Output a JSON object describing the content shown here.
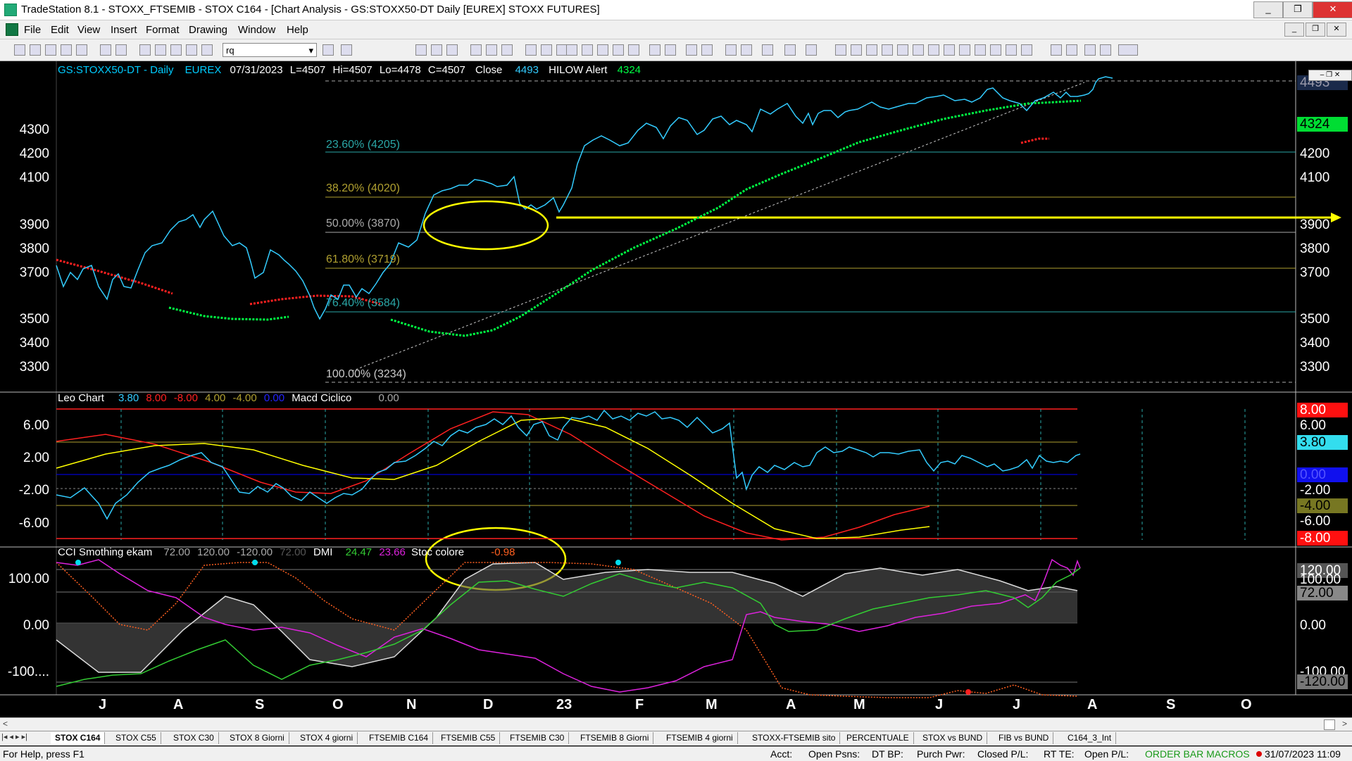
{
  "window": {
    "title": "TradeStation 8.1 - STOXX_FTSEMIB - STOX C164 - [Chart Analysis - GS:STOXX50-DT  Daily  [EUREX] STOXX FUTURES]",
    "controls": [
      "_",
      "❐",
      "✕"
    ]
  },
  "menu": {
    "items": [
      "File",
      "Edit",
      "View",
      "Insert",
      "Format",
      "Drawing",
      "Window",
      "Help"
    ]
  },
  "toolbar": {
    "symbol_value": "rq"
  },
  "price_panel": {
    "header": {
      "symbol": "GS:STOXX50-DT - Daily",
      "exchange": "EUREX",
      "date": "07/31/2023",
      "last": "L=4507",
      "high": "Hi=4507",
      "low": "Lo=4478",
      "close_val": "C=4507",
      "close_label": "Close",
      "close_num": "4493",
      "hilow": "HILOW Alert",
      "hilow_val": "4324"
    },
    "fib_levels": [
      "23.60% (4205)",
      "38.20% (4020)",
      "50.00% (3870)",
      "61.80% (3719)",
      "76.40% (3584)",
      "100.00% (3234)"
    ],
    "left_axis": [
      "4300",
      "4200",
      "4100",
      "3900",
      "3800",
      "3700",
      "3500",
      "3400",
      "3300"
    ],
    "right_axis": [
      "4200",
      "4100",
      "3900",
      "3800",
      "3700",
      "3500",
      "3400",
      "3300"
    ],
    "badge_green": "4324",
    "badge_top": "4493"
  },
  "osc_panel": {
    "header": {
      "name": "Leo Chart",
      "v1": "3.80",
      "v2": "8.00",
      "v3": "-8.00",
      "v4": "4.00",
      "v5": "-4.00",
      "v6": "0.00",
      "name2": "Macd Ciclico",
      "v7": "0.00"
    },
    "left_axis": [
      "6.00",
      "2.00",
      "-2.00",
      "-6.00"
    ],
    "right_axis": [
      "6.00",
      "-2.00",
      "-6.00"
    ],
    "badges": [
      "8.00",
      "3.80",
      "0.00",
      "-4.00",
      "-8.00"
    ]
  },
  "cci_panel": {
    "header": {
      "name": "CCI Smothing ekam",
      "v1": "72.00",
      "v2": "120.00",
      "v3": "-120.00",
      "v4": "72.00",
      "dmi": "DMI",
      "dmi1": "24.47",
      "dmi2": "23.66",
      "stoc": "Stoc colore",
      "stoc_val": "-0.98"
    },
    "left_axis": [
      "100.00",
      "0.00",
      "-100...."
    ],
    "right_axis": [
      "100.00",
      "0.00",
      "-100.00"
    ],
    "badges": [
      "120.00",
      "72.00",
      "-120.00"
    ]
  },
  "months": [
    "J",
    "A",
    "S",
    "O",
    "N",
    "D",
    "23",
    "F",
    "M",
    "A",
    "M",
    "J",
    "J",
    "A",
    "S",
    "O"
  ],
  "tabs": [
    "STOX C164",
    "STOX C55",
    "STOX  C30",
    "STOX  8 Giorni",
    "STOX 4 giorni",
    "FTSEMIB C164",
    "FTSEMIB C55",
    "FTSEMIB C30",
    "FTSEMIB  8 Giorni",
    "FTSEMIB  4 giorni",
    "STOXX-FTSEMIB sito",
    "PERCENTUALE",
    "STOX vs BUND",
    "FIB vs BUND",
    "C164_3_Int"
  ],
  "status": {
    "help": "For Help, press F1",
    "acct": "Acct:",
    "open_psns": "Open Psns:",
    "dt_bp": "DT BP:",
    "purch_pwr": "Purch Pwr:",
    "closed_pl": "Closed P/L:",
    "rt_te": "RT TE:",
    "open_pl": "Open P/L:",
    "macros": "ORDER BAR  MACROS",
    "datetime": "31/07/2023 11:09"
  },
  "colors": {
    "price": "#33ccff",
    "ma_green": "#00ff44",
    "ma_red": "#ff2020",
    "fib_teal": "#2aa7a7",
    "fib_olive": "#b0a030",
    "yellow": "#ffff00",
    "magenta": "#dd22dd",
    "header_text": "#00ccff"
  }
}
